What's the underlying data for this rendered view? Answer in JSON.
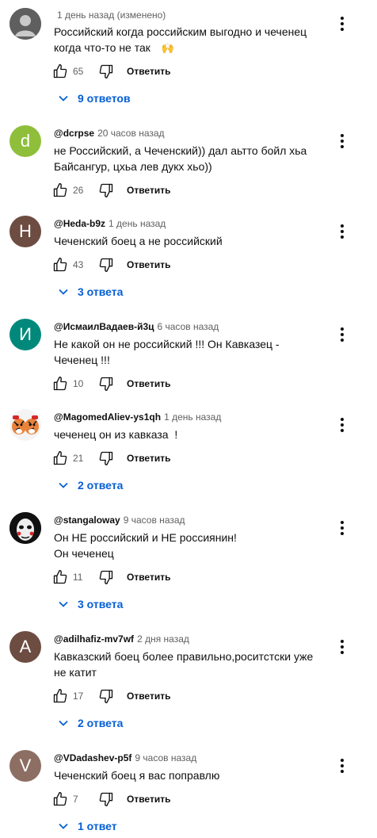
{
  "comments": [
    {
      "author": "",
      "time": "1 день назад (изменено)",
      "text": [
        "Российский когда российским выгодно и чеченец",
        "когда что-то не так"
      ],
      "emoji": "🙌",
      "likes": "65",
      "reply_label": "Ответить",
      "replies": "9 ответов",
      "avatar_letter": "",
      "avatar_color": "#666666"
    },
    {
      "author": "@dcrpse",
      "time": "20 часов назад",
      "text": [
        "не Российский, а Чеченский)) дал аьтто бойл хьа",
        "Байсангур, цхьа лев дукх хьо))"
      ],
      "likes": "26",
      "reply_label": "Ответить",
      "replies": "",
      "avatar_letter": "d",
      "avatar_color": "#8fbf3a"
    },
    {
      "author": "@Heda-b9z",
      "time": "1 день назад",
      "text": [
        "Чеченский боец а не российский"
      ],
      "likes": "43",
      "reply_label": "Ответить",
      "replies": "3 ответа",
      "avatar_letter": "H",
      "avatar_color": "#6d4c41"
    },
    {
      "author": "@ИсмаилВадаев-й3ц",
      "time": "6 часов назад",
      "text": [
        "Не какой он не российский !!! Он Кавказец -",
        "Чеченец !!!"
      ],
      "likes": "10",
      "reply_label": "Ответить",
      "replies": "",
      "avatar_letter": "И",
      "avatar_color": "#00897b"
    },
    {
      "author": "@MagomedAliev-ys1qh",
      "time": "1 день назад",
      "text": [
        "чеченец он из кавказа  !"
      ],
      "likes": "21",
      "reply_label": "Ответить",
      "replies": "2 ответа",
      "avatar_letter": "",
      "avatar_color": "#e8833a"
    },
    {
      "author": "@stangaloway",
      "time": "9 часов назад",
      "text": [
        "Он НЕ российский и НЕ россиянин!",
        "Он чеченец"
      ],
      "likes": "11",
      "reply_label": "Ответить",
      "replies": "3 ответа",
      "avatar_letter": "",
      "avatar_color": "#111111"
    },
    {
      "author": "@adilhafiz-mv7wf",
      "time": "2 дня назад",
      "text": [
        "Кавказский боец более правильно,роситстски уже",
        "не катит"
      ],
      "likes": "17",
      "reply_label": "Ответить",
      "replies": "2 ответа",
      "avatar_letter": "A",
      "avatar_color": "#6d4c41"
    },
    {
      "author": "@VDadashev-p5f",
      "time": "9 часов назад",
      "text": [
        "Чеченский боец я вас поправлю"
      ],
      "likes": "7",
      "reply_label": "Ответить",
      "replies": "1 ответ",
      "avatar_letter": "V",
      "avatar_color": "#8d6e63"
    }
  ],
  "colors": {
    "link": "#065fd4",
    "meta": "#606060",
    "text": "#0f0f0f"
  }
}
